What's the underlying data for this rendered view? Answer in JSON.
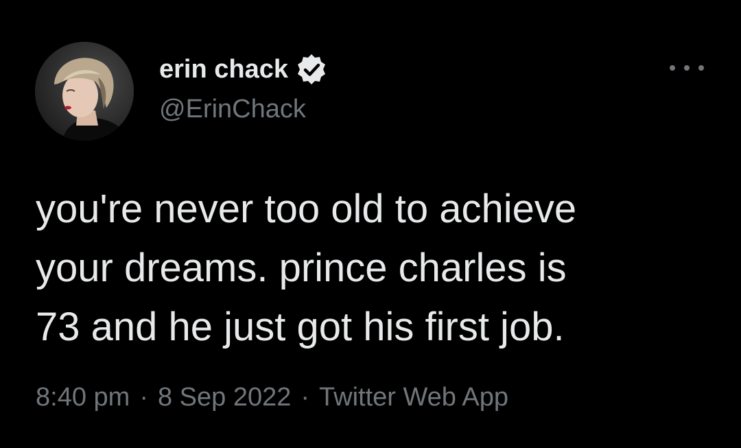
{
  "author": {
    "display_name": "erin chack",
    "handle": "@ErinChack",
    "verified": true,
    "avatar": "profile-photo"
  },
  "tweet": {
    "lines": [
      "you're never too old to achieve",
      "your dreams. prince charles is",
      "73 and he just got his first job."
    ]
  },
  "meta": {
    "time": "8:40 pm",
    "separator": "·",
    "date": "8 Sep 2022",
    "source": "Twitter Web App"
  },
  "icons": {
    "verified": "verified-badge-icon",
    "more": "more-options-icon"
  },
  "colors": {
    "background": "#000000",
    "primary_text": "#e7e9ea",
    "secondary_text": "#71767b",
    "badge": "#e7e9ea"
  }
}
